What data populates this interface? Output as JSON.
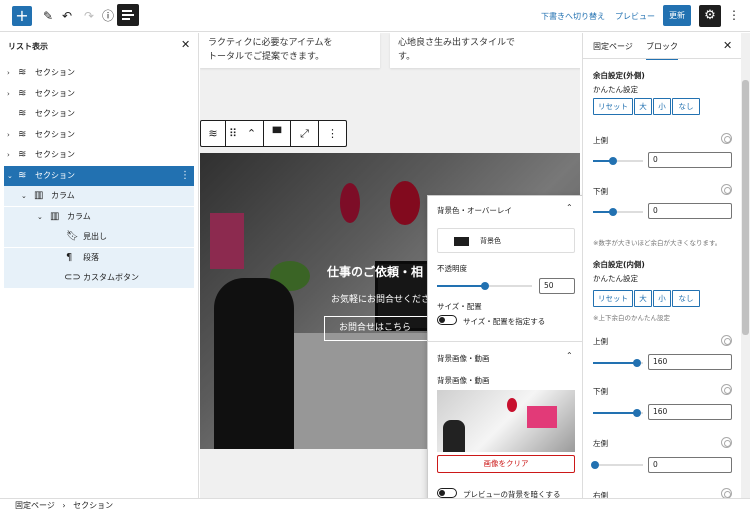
{
  "topbar": {
    "add_symbol": "+",
    "preview_draft_label": "下書きへ切り替え",
    "preview_label": "プレビュー",
    "update_label": "更新"
  },
  "list_view": {
    "title": "リスト表示",
    "items": [
      {
        "label": "セクション"
      },
      {
        "label": "セクション"
      },
      {
        "label": "セクション"
      },
      {
        "label": "セクション"
      },
      {
        "label": "セクション"
      },
      {
        "label": "セクション"
      },
      {
        "label": "カラム"
      },
      {
        "label": "カラム"
      },
      {
        "label": "見出し"
      },
      {
        "label": "段落"
      },
      {
        "label": "カスタムボタン"
      }
    ]
  },
  "canvas": {
    "card1_text_line1": "ラクティクに必要なアイテムを",
    "card1_text_line2": "トータルでご提案できます。",
    "card2_text_line1": "心地良さ生み出すスタイルで",
    "card2_text_line2": "す。",
    "hero_title": "仕事のご依頼・相",
    "hero_subtitle": "お気軽にお問合せくださ",
    "hero_button": "お問合せはこちら"
  },
  "popover": {
    "section1_title": "背景色・オーバーレイ",
    "color_label": "背景色",
    "opacity_label": "不透明度",
    "opacity_value": "50",
    "opacity_fraction": 0.5,
    "size_label": "サイズ・配置",
    "size_toggle_label": "サイズ・配置を指定する",
    "section2_title": "背景画像・動画",
    "image_label": "背景画像・動画",
    "clear_button": "画像をクリア",
    "darken_toggle_label": "プレビューの背景を暗くする"
  },
  "sidebar": {
    "tab_page": "固定ページ",
    "tab_block": "ブロック",
    "outer_title": "余白設定(外側)",
    "easy_label": "かんたん設定",
    "buttons": [
      "リセット",
      "大",
      "小",
      "なし"
    ],
    "top_label": "上側",
    "top_value": "0",
    "bottom_label": "下側",
    "bottom_value": "0",
    "outer_note": "※数字が大きいほど余白が大きくなります。",
    "inner_title": "余白設定(内側)",
    "inner_easy_label": "かんたん設定",
    "inner_note": "※上下余白のかんたん設定",
    "inner_top_label": "上側",
    "inner_top_value": "160",
    "inner_bottom_label": "下側",
    "inner_bottom_value": "160",
    "left_label": "左側",
    "left_value": "0",
    "right_label": "右側",
    "accent_color": "#2271b1"
  },
  "breadcrumb": {
    "root": "固定ページ",
    "separator": "›",
    "current": "セクション"
  }
}
